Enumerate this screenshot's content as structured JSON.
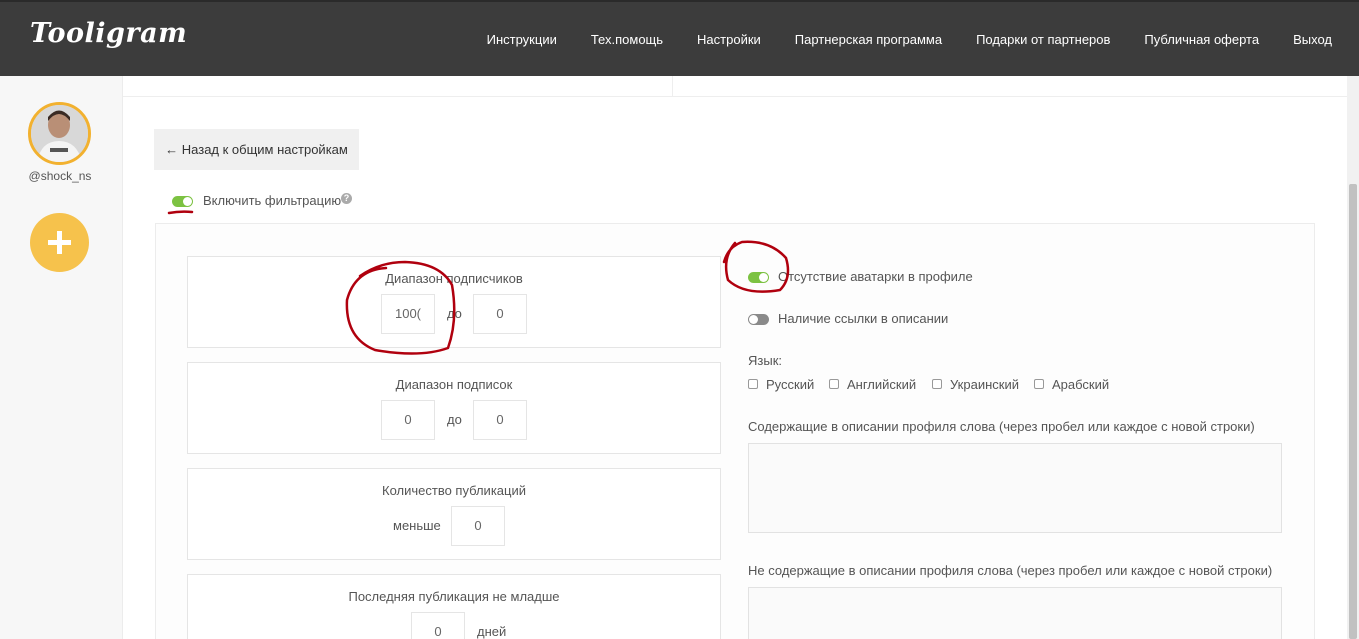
{
  "header": {
    "logo": "Tooligram",
    "nav": [
      "Инструкции",
      "Тех.помощь",
      "Настройки",
      "Партнерская программа",
      "Подарки от партнеров",
      "Публичная оферта",
      "Выход"
    ]
  },
  "sidebar": {
    "username": "@shock_ns"
  },
  "main": {
    "back_button": "← Назад к общим настройкам",
    "enable_filter": {
      "label": "Включить фильтрацию",
      "on": true
    },
    "followers_range": {
      "title": "Диапазон подписчиков",
      "from": "100(",
      "to_label": "до",
      "to": "0"
    },
    "following_range": {
      "title": "Диапазон подписок",
      "from": "0",
      "to_label": "до",
      "to": "0"
    },
    "posts_count": {
      "title": "Количество публикаций",
      "less_label": "меньше",
      "value": "0"
    },
    "last_post": {
      "title": "Последняя публикация не младше",
      "value": "0",
      "unit": "дней"
    },
    "no_avatar": {
      "label": "Отсутствие аватарки в профиле",
      "on": true
    },
    "has_link": {
      "label": "Наличие ссылки в описании",
      "on": false
    },
    "language": {
      "label": "Язык:",
      "options": [
        "Русский",
        "Английский",
        "Украинский",
        "Арабский"
      ]
    },
    "contains_words_label": "Содержащие в описании профиля слова (через пробел или каждое с новой строки)",
    "not_contains_words_label": "Не содержащие в описании профиля слова (через пробел или каждое с новой строки)"
  },
  "colors": {
    "toggle_on": "#7cc242",
    "accent_yellow": "#f6c24c",
    "annotation_red": "#b0000e",
    "header_bg": "#3c3c3c"
  }
}
